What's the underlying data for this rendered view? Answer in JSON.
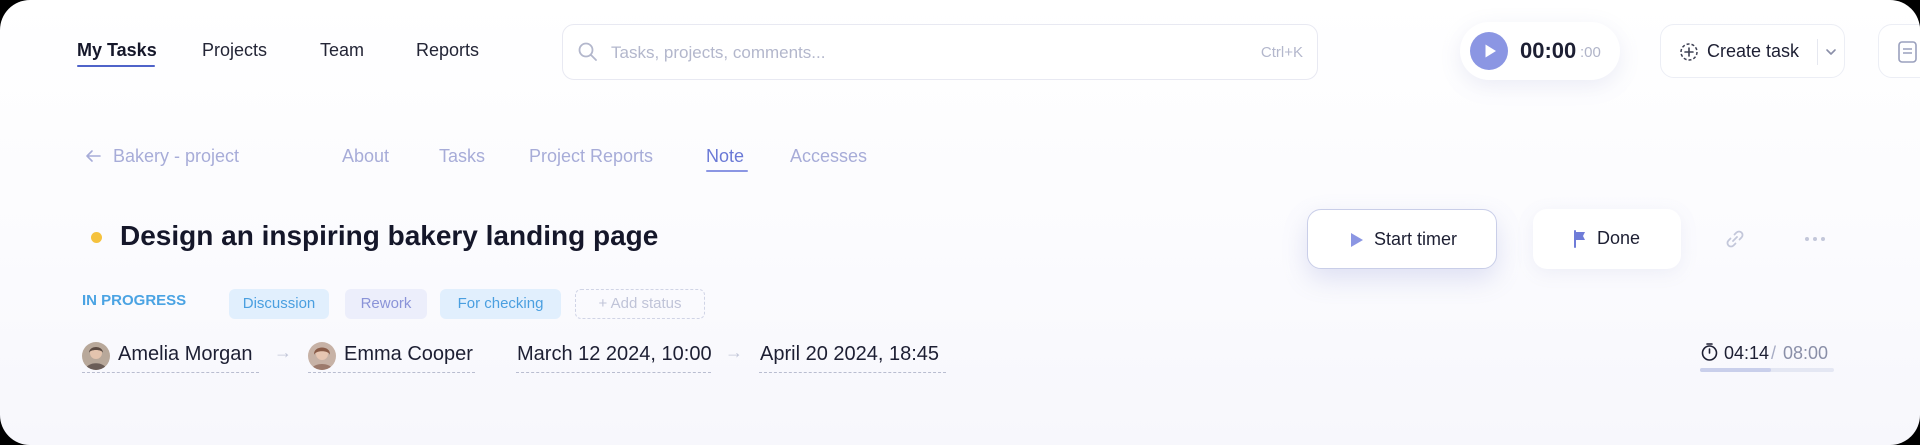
{
  "nav": {
    "items": [
      {
        "label": "My Tasks",
        "active": true
      },
      {
        "label": "Projects",
        "active": false
      },
      {
        "label": "Team",
        "active": false
      },
      {
        "label": "Reports",
        "active": false
      }
    ]
  },
  "search": {
    "placeholder": "Tasks, projects, comments...",
    "shortcut": "Ctrl+K",
    "icon": "search-icon"
  },
  "global_timer": {
    "main": "00:00",
    "seconds": ":00",
    "icon": "play-icon"
  },
  "create_task": {
    "label": "Create task",
    "icon": "plus-circle-icon",
    "dropdown_icon": "chevron-down-icon"
  },
  "side_button": {
    "icon": "notes-icon"
  },
  "subnav": {
    "back_label": "Bakery - project",
    "back_icon": "arrow-left-icon",
    "tabs": [
      {
        "label": "About",
        "active": false
      },
      {
        "label": "Tasks",
        "active": false
      },
      {
        "label": "Project Reports",
        "active": false
      },
      {
        "label": "Note",
        "active": true
      },
      {
        "label": "Accesses",
        "active": false
      }
    ]
  },
  "task": {
    "title": "Design an inspiring bakery landing page",
    "status_dot_color": "#f5c23e",
    "status": "IN PROGRESS",
    "tags": [
      "Discussion",
      "Rework",
      "For checking"
    ],
    "add_status": "+ Add status",
    "actions": {
      "start_timer": "Start timer",
      "done": "Done",
      "link_icon": "link-icon",
      "more_icon": "more-dots-icon"
    },
    "assigner": "Amelia Morgan",
    "assignee": "Emma Cooper",
    "start_date": "March 12 2024, 10:00",
    "end_date": "April 20 2024, 18:45",
    "time_spent": "04:14",
    "time_separator": "/",
    "time_estimate": "08:00",
    "time_progress": 0.53
  },
  "colors": {
    "accent": "#8b96e3",
    "status_blue": "#4aa3e3",
    "text": "#1d1f33"
  }
}
